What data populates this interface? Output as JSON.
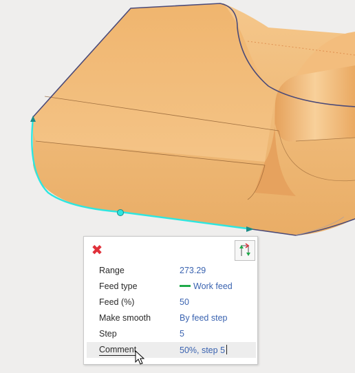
{
  "panel": {
    "close_icon": "close-icon",
    "direction_icon": "toolpath-direction-icon",
    "rows": [
      {
        "label": "Range",
        "value": "273.29"
      },
      {
        "label": "Feed type",
        "value": "Work feed",
        "swatch": "#1faa4a"
      },
      {
        "label": "Feed (%)",
        "value": "50"
      },
      {
        "label": "Make smooth",
        "value": "By feed step"
      },
      {
        "label": "Step",
        "value": "5"
      },
      {
        "label": "Comment",
        "value": "50%, step 5"
      }
    ]
  },
  "colors": {
    "part_fill": "#f2bd7a",
    "path_color": "#2ee6e0",
    "edge_color": "#4b4a78",
    "value_color": "#3a63b0",
    "close_color": "#e0303a"
  }
}
